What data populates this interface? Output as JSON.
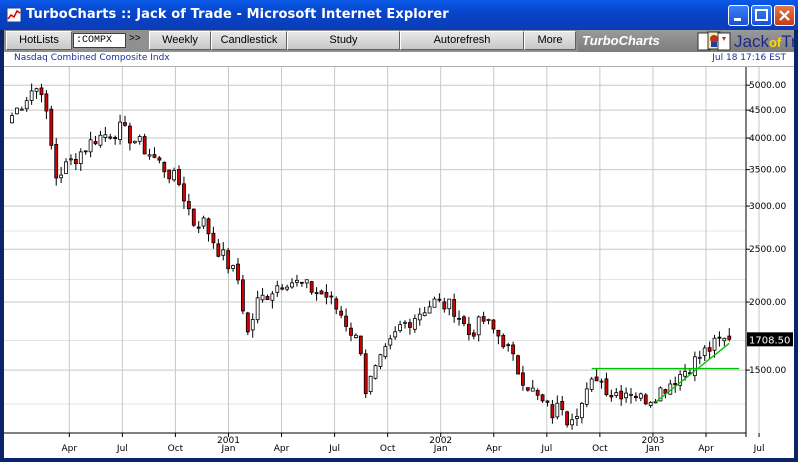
{
  "window": {
    "title": "TurboCharts :: Jack of Trade - Microsoft Internet Explorer"
  },
  "toolbar": {
    "hotlists": "HotLists",
    "symbol": ":COMPX",
    "symbol_arrows": ">>",
    "weekly": "Weekly",
    "candlestick": "Candlestick",
    "study": "Study",
    "autorefresh": "Autorefresh",
    "more": "More",
    "brand": "TurboCharts",
    "logo_jack": "Jack",
    "logo_of": "of",
    "logo_tr": "Tr"
  },
  "info": {
    "name": "Nasdaq Combined Composite Indx",
    "date": "Jul 18 17:16 EST"
  },
  "colors": {
    "up": "#ffffff",
    "down": "#d40000",
    "trendline": "#00c000",
    "grid": "#c8c8c8",
    "text": "#1a2fa0"
  },
  "chart_data": {
    "type": "candlestick",
    "scale": "log",
    "ylim": [
      1150,
      5400
    ],
    "y_ticks": [
      1500,
      2000,
      2500,
      3000,
      3500,
      4000,
      4500,
      5000
    ],
    "y_tick_labels": [
      "1500.00",
      "2000.00",
      "2500.00",
      "3000.00",
      "3500.00",
      "4000.00",
      "4500.00",
      "5000.00"
    ],
    "x_months": [
      "Apr",
      "Jul",
      "Oct",
      "Jan",
      "Apr",
      "Jul",
      "Oct",
      "Jan",
      "Apr",
      "Jul",
      "Oct",
      "Jan",
      "Apr",
      "Jul"
    ],
    "x_years": [
      {
        "label": "2001",
        "month_index": 3
      },
      {
        "label": "2002",
        "month_index": 7
      },
      {
        "label": "2003",
        "month_index": 11
      }
    ],
    "last_value_label": "1708.50",
    "last_value": 1708.5,
    "anchors": [
      [
        0,
        4400
      ],
      [
        4,
        4900
      ],
      [
        6,
        4950
      ],
      [
        9,
        3400
      ],
      [
        13,
        3700
      ],
      [
        17,
        4000
      ],
      [
        22,
        4150
      ],
      [
        26,
        3900
      ],
      [
        30,
        3600
      ],
      [
        34,
        3300
      ],
      [
        37,
        2800
      ],
      [
        39,
        2800
      ],
      [
        42,
        2500
      ],
      [
        46,
        2200
      ],
      [
        48,
        1750
      ],
      [
        50,
        2000
      ],
      [
        54,
        2150
      ],
      [
        56,
        2200
      ],
      [
        60,
        2130
      ],
      [
        64,
        2050
      ],
      [
        67,
        1900
      ],
      [
        71,
        1650
      ],
      [
        72,
        1380
      ],
      [
        75,
        1550
      ],
      [
        79,
        1800
      ],
      [
        84,
        1950
      ],
      [
        86,
        2000
      ],
      [
        90,
        1950
      ],
      [
        93,
        1750
      ],
      [
        96,
        1850
      ],
      [
        100,
        1700
      ],
      [
        103,
        1500
      ],
      [
        107,
        1330
      ],
      [
        110,
        1250
      ],
      [
        112,
        1300
      ],
      [
        113,
        1230
      ],
      [
        116,
        1300
      ],
      [
        119,
        1470
      ],
      [
        122,
        1360
      ],
      [
        126,
        1380
      ],
      [
        128,
        1330
      ],
      [
        130,
        1340
      ],
      [
        133,
        1400
      ],
      [
        137,
        1500
      ],
      [
        141,
        1620
      ],
      [
        144,
        1690
      ],
      [
        146,
        1708.5
      ]
    ],
    "trendlines": [
      {
        "x1": 118,
        "y1": 1510,
        "x2": 148,
        "y2": 1510
      },
      {
        "x1": 131,
        "y1": 1310,
        "x2": 146,
        "y2": 1680
      }
    ]
  }
}
